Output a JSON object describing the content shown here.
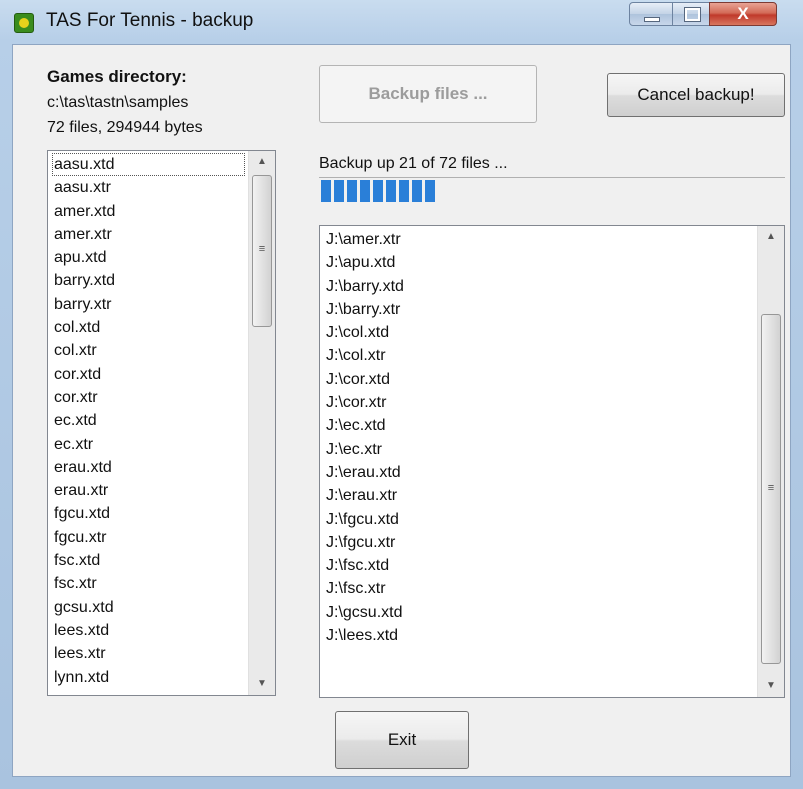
{
  "window": {
    "title": "TAS For Tennis - backup",
    "controls": {
      "minimize": "–",
      "maximize": "□",
      "close": "X"
    }
  },
  "games": {
    "heading": "Games directory:",
    "path": "c:\\tas\\tastn\\samples",
    "info": "72 files, 294944 bytes",
    "files": [
      "aasu.xtd",
      "aasu.xtr",
      "amer.xtd",
      "amer.xtr",
      "apu.xtd",
      "barry.xtd",
      "barry.xtr",
      "col.xtd",
      "col.xtr",
      "cor.xtd",
      "cor.xtr",
      "ec.xtd",
      "ec.xtr",
      "erau.xtd",
      "erau.xtr",
      "fgcu.xtd",
      "fgcu.xtr",
      "fsc.xtd",
      "fsc.xtr",
      "gcsu.xtd",
      "lees.xtd",
      "lees.xtr",
      "lynn.xtd"
    ]
  },
  "buttons": {
    "backup": "Backup files ...",
    "cancel": "Cancel backup!",
    "exit": "Exit"
  },
  "progress": {
    "status": "Backup up 21 of 72 files ...",
    "fraction": 0.29,
    "segments": 9,
    "color": "#2a7fd8"
  },
  "backup_log": [
    "J:\\amer.xtr",
    "J:\\apu.xtd",
    "J:\\barry.xtd",
    "J:\\barry.xtr",
    "J:\\col.xtd",
    "J:\\col.xtr",
    "J:\\cor.xtd",
    "J:\\cor.xtr",
    "J:\\ec.xtd",
    "J:\\ec.xtr",
    "J:\\erau.xtd",
    "J:\\erau.xtr",
    "J:\\fgcu.xtd",
    "J:\\fgcu.xtr",
    "J:\\fsc.xtd",
    "J:\\fsc.xtr",
    "J:\\gcsu.xtd",
    "J:\\lees.xtd"
  ],
  "icons": [
    "app-icon",
    "minimize-icon",
    "maximize-icon",
    "close-icon",
    "scroll-up-arrow-icon",
    "scroll-down-arrow-icon"
  ]
}
